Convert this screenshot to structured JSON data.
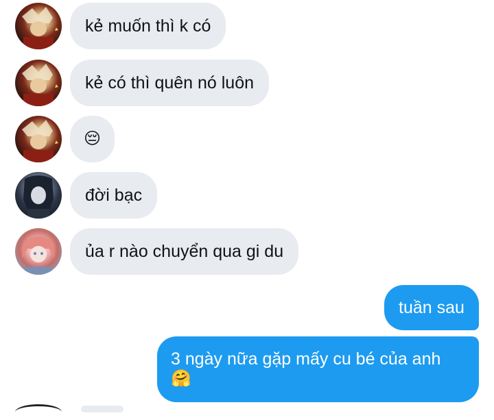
{
  "messages": [
    {
      "side": "in",
      "text": "kẻ muốn thì k có"
    },
    {
      "side": "in",
      "text": "kẻ có thì quên nó luôn"
    },
    {
      "side": "in",
      "emoji": "😔"
    },
    {
      "side": "in",
      "text": "đời bạc"
    },
    {
      "side": "in",
      "text": "ủa r nào chuyển qua gi du"
    },
    {
      "side": "out",
      "text": "tuần sau"
    },
    {
      "side": "out",
      "text": "3 ngày nữa gặp mấy cu bé của anh",
      "emoji": "🤗"
    }
  ],
  "colors": {
    "incoming_bubble": "#e8ebef",
    "outgoing_bubble": "#1d9bf0",
    "incoming_text": "#101418",
    "outgoing_text": "#ffffff"
  },
  "icons": {
    "avatar_1": "anime-avatar-red-hair",
    "avatar_2": "anime-avatar-dark-hair",
    "avatar_3": "anime-avatar-pink-hair"
  }
}
